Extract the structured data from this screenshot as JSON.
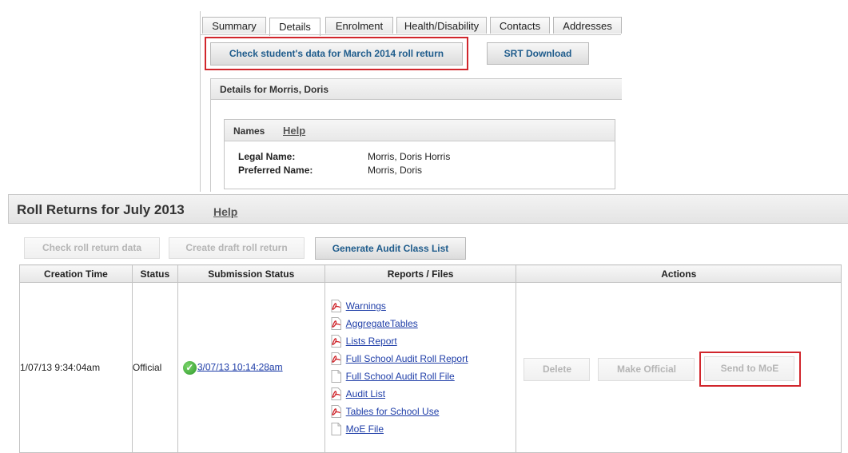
{
  "tabs": [
    "Summary",
    "Details",
    "Enrolment",
    "Health/Disability",
    "Contacts",
    "Addresses"
  ],
  "active_tab": "Details",
  "top_buttons": {
    "check_data": "Check student's data for March 2014 roll return",
    "srt_download": "SRT Download"
  },
  "details": {
    "title": "Details for Morris, Doris",
    "names_title": "Names",
    "help": "Help",
    "legal_name_label": "Legal Name:",
    "legal_name_value": "Morris, Doris Horris",
    "preferred_name_label": "Preferred Name:",
    "preferred_name_value": "Morris, Doris"
  },
  "roll": {
    "title": "Roll Returns for July 2013",
    "help": "Help",
    "buttons": {
      "check": "Check roll return data",
      "create": "Create draft roll return",
      "generate": "Generate Audit Class List"
    },
    "columns": [
      "Creation Time",
      "Status",
      "Submission Status",
      "Reports / Files",
      "Actions"
    ],
    "row": {
      "creation_time": "1/07/13 9:34:04am",
      "status": "Official",
      "submission": "3/07/13 10:14:28am",
      "files": [
        {
          "name": "Warnings",
          "icon": "pdf"
        },
        {
          "name": "AggregateTables",
          "icon": "pdf"
        },
        {
          "name": "Lists Report",
          "icon": "pdf"
        },
        {
          "name": "Full School Audit Roll Report",
          "icon": "pdf"
        },
        {
          "name": "Full School Audit Roll File",
          "icon": "doc"
        },
        {
          "name": "Audit List",
          "icon": "pdf"
        },
        {
          "name": "Tables for School Use",
          "icon": "pdf"
        },
        {
          "name": "MoE File",
          "icon": "doc"
        }
      ],
      "actions": {
        "delete": "Delete",
        "make_official": "Make Official",
        "send": "Send to MoE"
      }
    }
  },
  "colors": {
    "highlight": "#d1262c",
    "link": "#1f3ea8",
    "button_text": "#1f5c8c"
  }
}
